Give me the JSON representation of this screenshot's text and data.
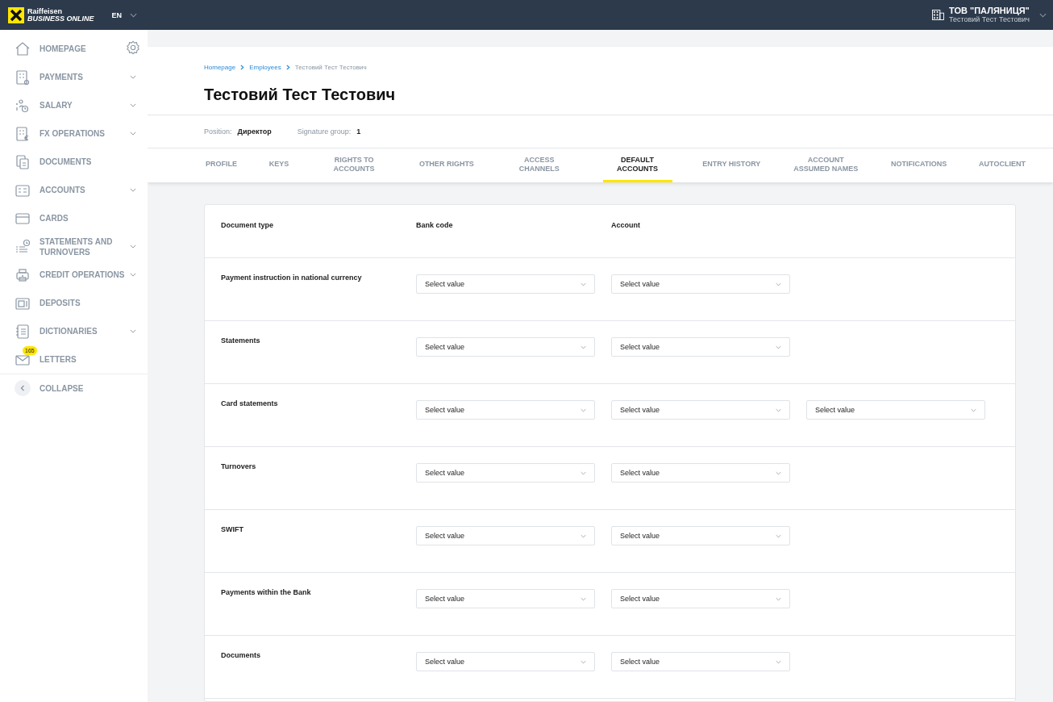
{
  "topbar": {
    "logo_line1": "Raiffeisen",
    "logo_line2": "BUSINESS ONLINE",
    "language": "EN",
    "company": "ТОВ \"ПАЛЯНИЦЯ\"",
    "user": "Тестовий Тест Тестович"
  },
  "sidebar": {
    "items": [
      {
        "label": "HOMEPAGE",
        "expandable": false
      },
      {
        "label": "PAYMENTS",
        "expandable": true
      },
      {
        "label": "SALARY",
        "expandable": true
      },
      {
        "label": "FX OPERATIONS",
        "expandable": true
      },
      {
        "label": "DOCUMENTS",
        "expandable": false
      },
      {
        "label": "ACCOUNTS",
        "expandable": true
      },
      {
        "label": "CARDS",
        "expandable": false
      },
      {
        "label": "STATEMENTS AND TURNOVERS",
        "expandable": true
      },
      {
        "label": "CREDIT OPERATIONS",
        "expandable": true
      },
      {
        "label": "DEPOSITS",
        "expandable": false
      },
      {
        "label": "DICTIONARIES",
        "expandable": true
      },
      {
        "label": "LETTERS",
        "expandable": false,
        "badge": "165"
      }
    ],
    "collapse": "COLLAPSE"
  },
  "breadcrumbs": [
    {
      "label": "Homepage",
      "link": true
    },
    {
      "label": "Employees",
      "link": true
    },
    {
      "label": "Тестовий Тест Тестович",
      "link": false
    }
  ],
  "title": "Тестовий Тест Тестович",
  "info": [
    {
      "label": "Position:",
      "value": "Директор"
    },
    {
      "label": "Signature group:",
      "value": "1"
    }
  ],
  "tabs": [
    {
      "label": "PROFILE",
      "selected": false
    },
    {
      "label": "KEYS",
      "selected": false
    },
    {
      "label": "RIGHTS TO ACCOUNTS",
      "selected": false
    },
    {
      "label": "OTHER RIGHTS",
      "selected": false
    },
    {
      "label": "ACCESS CHANNELS",
      "selected": false
    },
    {
      "label": "DEFAULT ACCOUNTS",
      "selected": true
    },
    {
      "label": "ENTRY HISTORY",
      "selected": false
    },
    {
      "label": "ACCOUNT ASSUMED NAMES",
      "selected": false
    },
    {
      "label": "NOTIFICATIONS",
      "selected": false
    },
    {
      "label": "AUTOCLIENT",
      "selected": false
    }
  ],
  "table": {
    "columns": [
      "Document type",
      "Bank code",
      "Account"
    ],
    "rows": [
      {
        "document_type": "Payment instruction in national currency",
        "selects": [
          "Select value",
          "Select value"
        ]
      },
      {
        "document_type": "Statements",
        "selects": [
          "Select value",
          "Select value"
        ]
      },
      {
        "document_type": "Card statements",
        "selects": [
          "Select value",
          "Select value",
          "Select value"
        ]
      },
      {
        "document_type": "Turnovers",
        "selects": [
          "Select value",
          "Select value"
        ]
      },
      {
        "document_type": "SWIFT",
        "selects": [
          "Select value",
          "Select value"
        ]
      },
      {
        "document_type": "Payments within the Bank",
        "selects": [
          "Select value",
          "Select value"
        ]
      },
      {
        "document_type": "Documents",
        "selects": [
          "Select value",
          "Select value"
        ]
      }
    ]
  }
}
